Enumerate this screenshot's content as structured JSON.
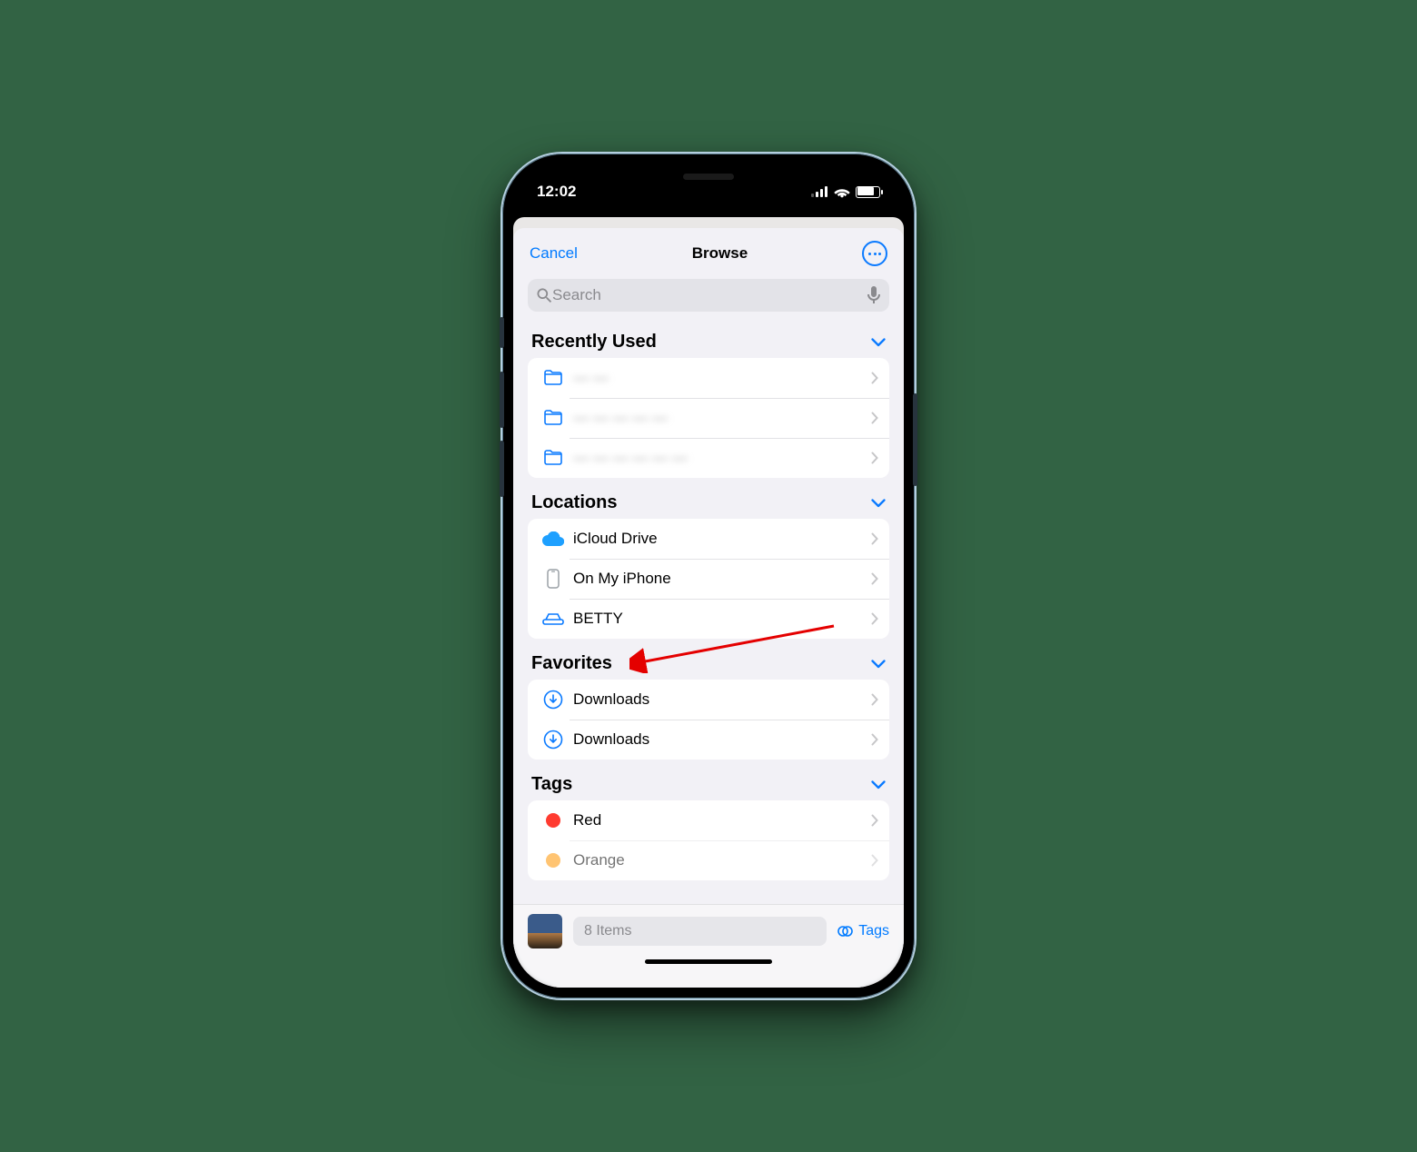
{
  "status": {
    "time": "12:02"
  },
  "nav": {
    "cancel": "Cancel",
    "title": "Browse"
  },
  "search": {
    "placeholder": "Search"
  },
  "sections": {
    "recent": {
      "title": "Recently Used",
      "items": [
        {
          "label": "— —"
        },
        {
          "label": "— — — — —"
        },
        {
          "label": "— — — — — —"
        }
      ]
    },
    "locations": {
      "title": "Locations",
      "items": [
        {
          "label": "iCloud Drive"
        },
        {
          "label": "On My iPhone"
        },
        {
          "label": "BETTY"
        }
      ]
    },
    "favorites": {
      "title": "Favorites",
      "items": [
        {
          "label": "Downloads"
        },
        {
          "label": "Downloads"
        }
      ]
    },
    "tags": {
      "title": "Tags",
      "items": [
        {
          "label": "Red",
          "color": "#ff3b30"
        },
        {
          "label": "Orange",
          "color": "#ff9500"
        }
      ]
    }
  },
  "bottom": {
    "count_label": "8 Items",
    "tags_label": "Tags"
  }
}
